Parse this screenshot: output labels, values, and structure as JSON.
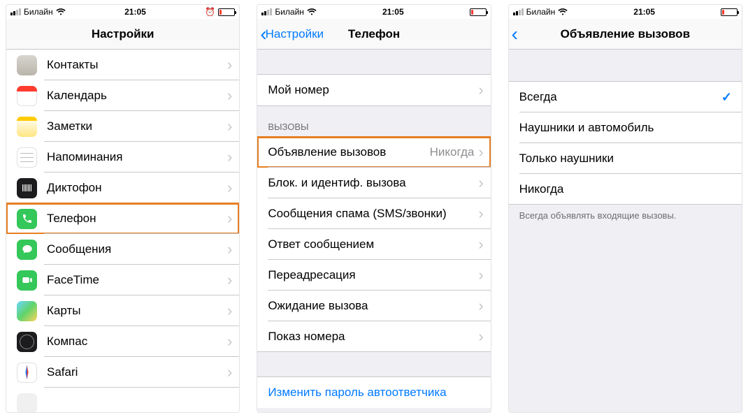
{
  "status": {
    "carrier": "Билайн",
    "time": "21:05"
  },
  "screen1": {
    "title": "Настройки",
    "items": [
      {
        "label": "Контакты"
      },
      {
        "label": "Календарь"
      },
      {
        "label": "Заметки"
      },
      {
        "label": "Напоминания"
      },
      {
        "label": "Диктофон"
      },
      {
        "label": "Телефон"
      },
      {
        "label": "Сообщения"
      },
      {
        "label": "FaceTime"
      },
      {
        "label": "Карты"
      },
      {
        "label": "Компас"
      },
      {
        "label": "Safari"
      }
    ]
  },
  "screen2": {
    "back": "Настройки",
    "title": "Телефон",
    "my_number": "Мой номер",
    "section_calls": "ВЫЗОВЫ",
    "announce": {
      "label": "Объявление вызовов",
      "value": "Никогда"
    },
    "items2": [
      {
        "label": "Блок. и идентиф. вызова"
      },
      {
        "label": "Сообщения спама (SMS/звонки)"
      },
      {
        "label": "Ответ сообщением"
      },
      {
        "label": "Переадресация"
      },
      {
        "label": "Ожидание вызова"
      },
      {
        "label": "Показ номера"
      }
    ],
    "change_pass": "Изменить пароль автоответчика"
  },
  "screen3": {
    "title": "Объявление вызовов",
    "options": [
      {
        "label": "Всегда",
        "selected": true
      },
      {
        "label": "Наушники и автомобиль",
        "selected": false
      },
      {
        "label": "Только наушники",
        "selected": false
      },
      {
        "label": "Никогда",
        "selected": false
      }
    ],
    "footer": "Всегда объявлять входящие вызовы."
  }
}
